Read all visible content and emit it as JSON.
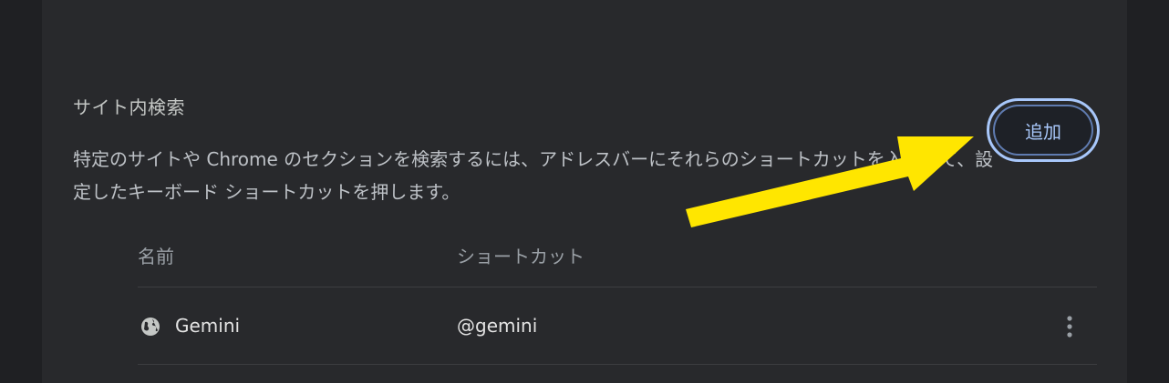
{
  "section": {
    "title": "サイト内検索",
    "description": "特定のサイトや Chrome のセクションを検索するには、アドレスバーにそれらのショートカットを入力して、設定したキーボード ショートカットを押します。",
    "add_label": "追加"
  },
  "table": {
    "headers": {
      "name": "名前",
      "shortcut": "ショートカット"
    },
    "rows": [
      {
        "icon": "globe-icon",
        "name": "Gemini",
        "shortcut": "@gemini"
      }
    ]
  },
  "colors": {
    "accent": "#a8c7fa",
    "annotation_arrow": "#ffe600",
    "panel_bg": "#28292c",
    "page_bg": "#1f2023"
  }
}
